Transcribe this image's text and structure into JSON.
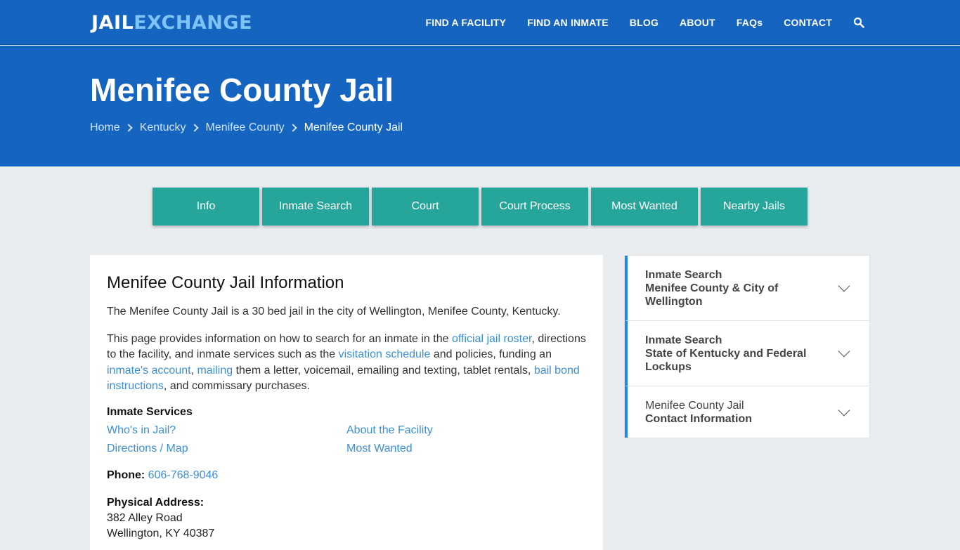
{
  "brand": {
    "part1": "JAIL",
    "part2": "EXCHANGE"
  },
  "nav": {
    "items": [
      "FIND A FACILITY",
      "FIND AN INMATE",
      "BLOG",
      "ABOUT",
      "FAQs",
      "CONTACT"
    ],
    "search_icon": "search-icon"
  },
  "hero": {
    "title": "Menifee County Jail",
    "breadcrumbs": [
      "Home",
      "Kentucky",
      "Menifee County",
      "Menifee County Jail"
    ]
  },
  "tabs": [
    "Info",
    "Inmate Search",
    "Court",
    "Court Process",
    "Most Wanted",
    "Nearby Jails"
  ],
  "info": {
    "heading": "Menifee County Jail Information",
    "intro": "The Menifee County Jail is a 30 bed jail in the city of Wellington, Menifee County, Kentucky.",
    "para": {
      "t1": "This page provides information on how to search for an inmate in the ",
      "l1": "official jail roster",
      "t2": ", directions to the facility, and inmate services such as the ",
      "l2": "visitation schedule",
      "t3": " and policies, funding an ",
      "l3": "inmate's account",
      "t4": ", ",
      "l4": "mailing",
      "t5": " them a letter, voicemail, emailing and texting, tablet rentals, ",
      "l5": "bail bond instructions",
      "t6": ", and commissary purchases."
    },
    "services_title": "Inmate Services",
    "services": [
      "Who's in Jail?",
      "About the Facility",
      "Directions / Map",
      "Most Wanted"
    ],
    "phone_label": "Phone:",
    "phone": "606-768-9046",
    "address_label": "Physical Address:",
    "address_line1": "382 Alley Road",
    "address_line2": "Wellington, KY 40387"
  },
  "sidebar": [
    {
      "line1": "Inmate Search",
      "line2": "Menifee County & City of Wellington"
    },
    {
      "line1": "Inmate Search",
      "line2": "State of Kentucky and Federal Lockups"
    },
    {
      "line1": "Menifee County Jail",
      "line2": "Contact Information"
    }
  ],
  "colors": {
    "brand_blue": "#1565c0",
    "teal": "#26a69a",
    "link": "#3b8fd8",
    "accent": "#1e88e5"
  }
}
